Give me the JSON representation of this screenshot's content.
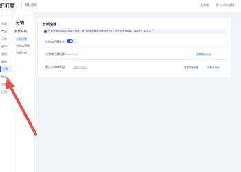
{
  "topbar": {
    "logo": "旺旺猫",
    "breadcrumb": "网站首页",
    "right_link": "去商城",
    "user": "小邓的店铺"
  },
  "sidebar": {
    "items": [
      {
        "label": "首页"
      },
      {
        "label": "商品"
      },
      {
        "label": "订单"
      },
      {
        "label": "客户"
      },
      {
        "label": "营销"
      },
      {
        "label": "数据"
      },
      {
        "label": "分销"
      },
      {
        "label": "财务"
      },
      {
        "label": "设置"
      },
      {
        "label": "应用"
      }
    ],
    "active_index": 6
  },
  "subnav": {
    "title": "分销",
    "group": "有赞分销",
    "items": [
      {
        "label": "分销设置",
        "active": true
      },
      {
        "label": "分销商管理",
        "active": false
      },
      {
        "label": "分销订单",
        "active": false
      }
    ]
  },
  "panel": {
    "title": "分销设置",
    "notice": "开启分销功能后可发展分销商，将分销商的佣金比例设置为0，可享受分销商推广带来的订单收益",
    "switch_label": "分销商招募开关",
    "switch_on": true,
    "recruit_label": "分销商招募链接",
    "recruit_value": "https://shop...",
    "recruit_link": "复制链接地址",
    "default_label": "默认分销商等级",
    "default_chip": "普通分销商",
    "default_link_1": "设置等级佣金",
    "default_link_2": "查看分销商"
  },
  "colors": {
    "accent": "#2b5cff",
    "arrow": "#e8504d"
  }
}
